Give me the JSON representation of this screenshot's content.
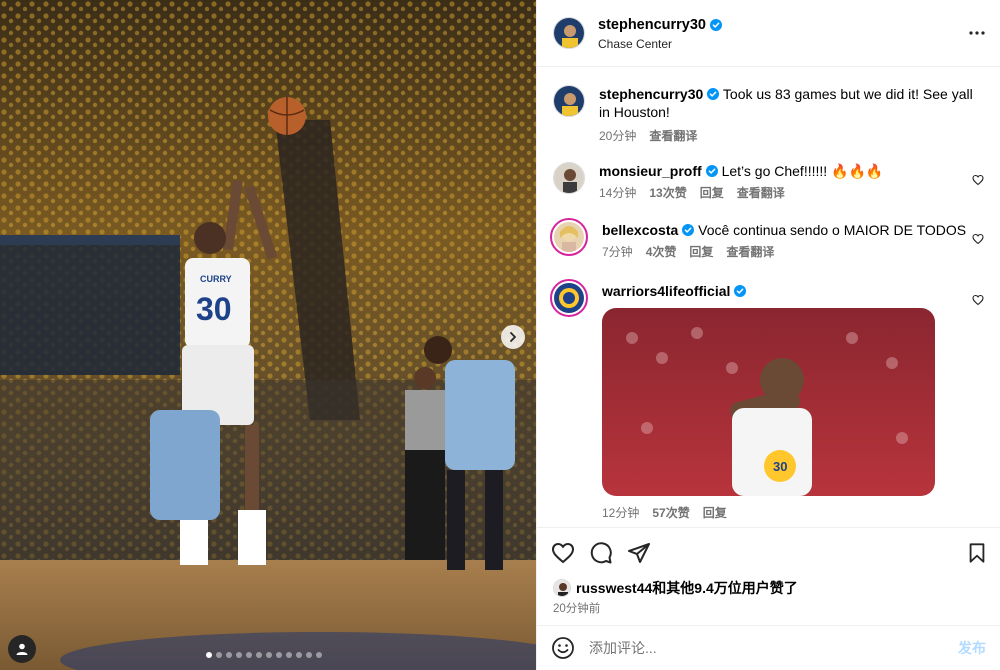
{
  "post": {
    "author": "stephencurry30",
    "location": "Chase Center",
    "caption": "Took us 83 games but we did it! See yall in Houston!",
    "caption_time": "20分钟",
    "see_translation": "查看翻译",
    "jersey_name": "CURRY",
    "jersey_number": "30",
    "carousel": {
      "total": 12,
      "current": 1
    }
  },
  "comments": [
    {
      "username": "monsieur_proff",
      "text": "Let’s go Chef!!!!!! 🔥🔥🔥",
      "time": "14分钟",
      "likes": "13次赞",
      "reply": "回复",
      "translate": "查看翻译"
    },
    {
      "username": "bellexcosta",
      "text": "Você continua sendo o MAIOR DE TODOS",
      "time": "7分钟",
      "likes": "4次赞",
      "reply": "回复",
      "translate": "查看翻译"
    },
    {
      "username": "warriors4lifeofficial",
      "text": "",
      "time": "12分钟",
      "likes": "57次赞",
      "reply": "回复",
      "gif_jersey_number": "30"
    }
  ],
  "footer": {
    "liked_by_user": "russwest44",
    "liked_by_rest": "和其他9.4万位用户赞了",
    "time_ago": "20分钟前",
    "comment_placeholder": "添加评论...",
    "post_label": "发布"
  },
  "colors": {
    "verified": "#0095f6",
    "post_button": "#b3dbff",
    "meta": "#737373",
    "story_ring": "#d6249f"
  },
  "icons": [
    "chevron-right-icon",
    "user-tag-icon",
    "more-icon",
    "verified-icon",
    "heart-icon",
    "comment-icon",
    "share-icon",
    "bookmark-icon",
    "emoji-icon"
  ]
}
